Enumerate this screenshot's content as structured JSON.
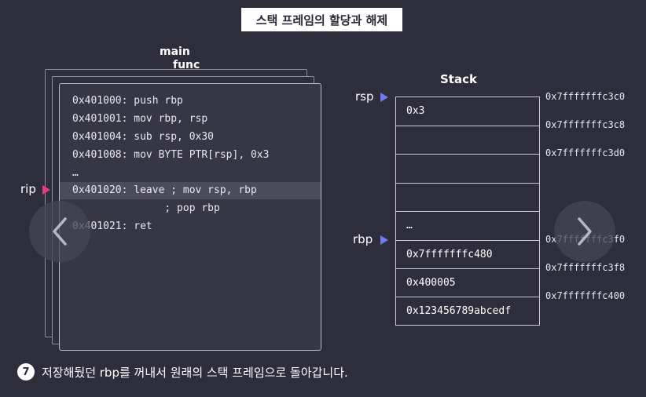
{
  "title": "스택 프레임의 할당과 해제",
  "frames": {
    "main_label": "main",
    "func_label": "func"
  },
  "code_lines": [
    "0x401000: push rbp",
    "0x401001: mov rbp, rsp",
    "0x401004: sub rsp, 0x30",
    "0x401008: mov BYTE PTR[rsp], 0x3",
    "…",
    "0x401020: leave ; mov rsp, rbp",
    "               ; pop rbp",
    "0x401021: ret"
  ],
  "active_line_index": 5,
  "pointers": {
    "rip": "rip",
    "rsp": "rsp",
    "rbp": "rbp"
  },
  "colors": {
    "rip_marker": "#e0407a",
    "stack_marker": "#6f7ee8",
    "background": "#2e2d3c"
  },
  "stack": {
    "title": "Stack",
    "cells": [
      "0x3",
      "",
      "",
      "",
      "…",
      "0x7fffffffc480",
      "0x400005",
      "0x123456789abcedf"
    ],
    "addresses": [
      "0x7fffffffc3c0",
      "0x7fffffffc3c8",
      "0x7fffffffc3d0",
      "0x7fffffffc3f0",
      "0x7fffffffc3f8",
      "0x7fffffffc400"
    ]
  },
  "nav": {
    "prev_icon": "chevron-left-icon",
    "next_icon": "chevron-right-icon"
  },
  "caption": {
    "step": "7",
    "text": "저장해뒀던 rbp를 꺼내서 원래의 스택 프레임으로 돌아갑니다."
  }
}
